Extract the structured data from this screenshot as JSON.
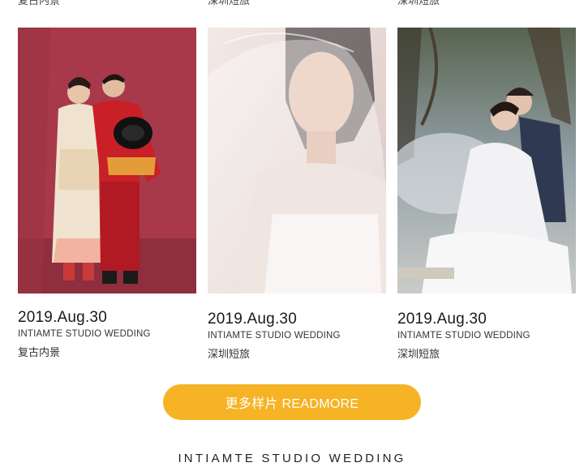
{
  "top_row_cut": [
    "复古内景",
    "深圳短旅",
    "深圳短旅"
  ],
  "cards": [
    {
      "date": "2019.Aug.30",
      "studio": "INTIAMTE STUDIO WEDDING",
      "tag": "复古内景"
    },
    {
      "date": "2019.Aug.30",
      "studio": "INTIAMTE STUDIO WEDDING",
      "tag": "深圳短旅"
    },
    {
      "date": "2019.Aug.30",
      "studio": "INTIAMTE STUDIO WEDDING",
      "tag": "深圳短旅"
    }
  ],
  "readmore_label": "更多样片 READMORE",
  "footer_brand": "INTIAMTE STUDIO WEDDING",
  "colors": {
    "button": "#f5b325",
    "photo1_bg": "#a8394a",
    "photo2_bg": "#e9dad5",
    "photo3_bg": "#6f7b6a"
  }
}
